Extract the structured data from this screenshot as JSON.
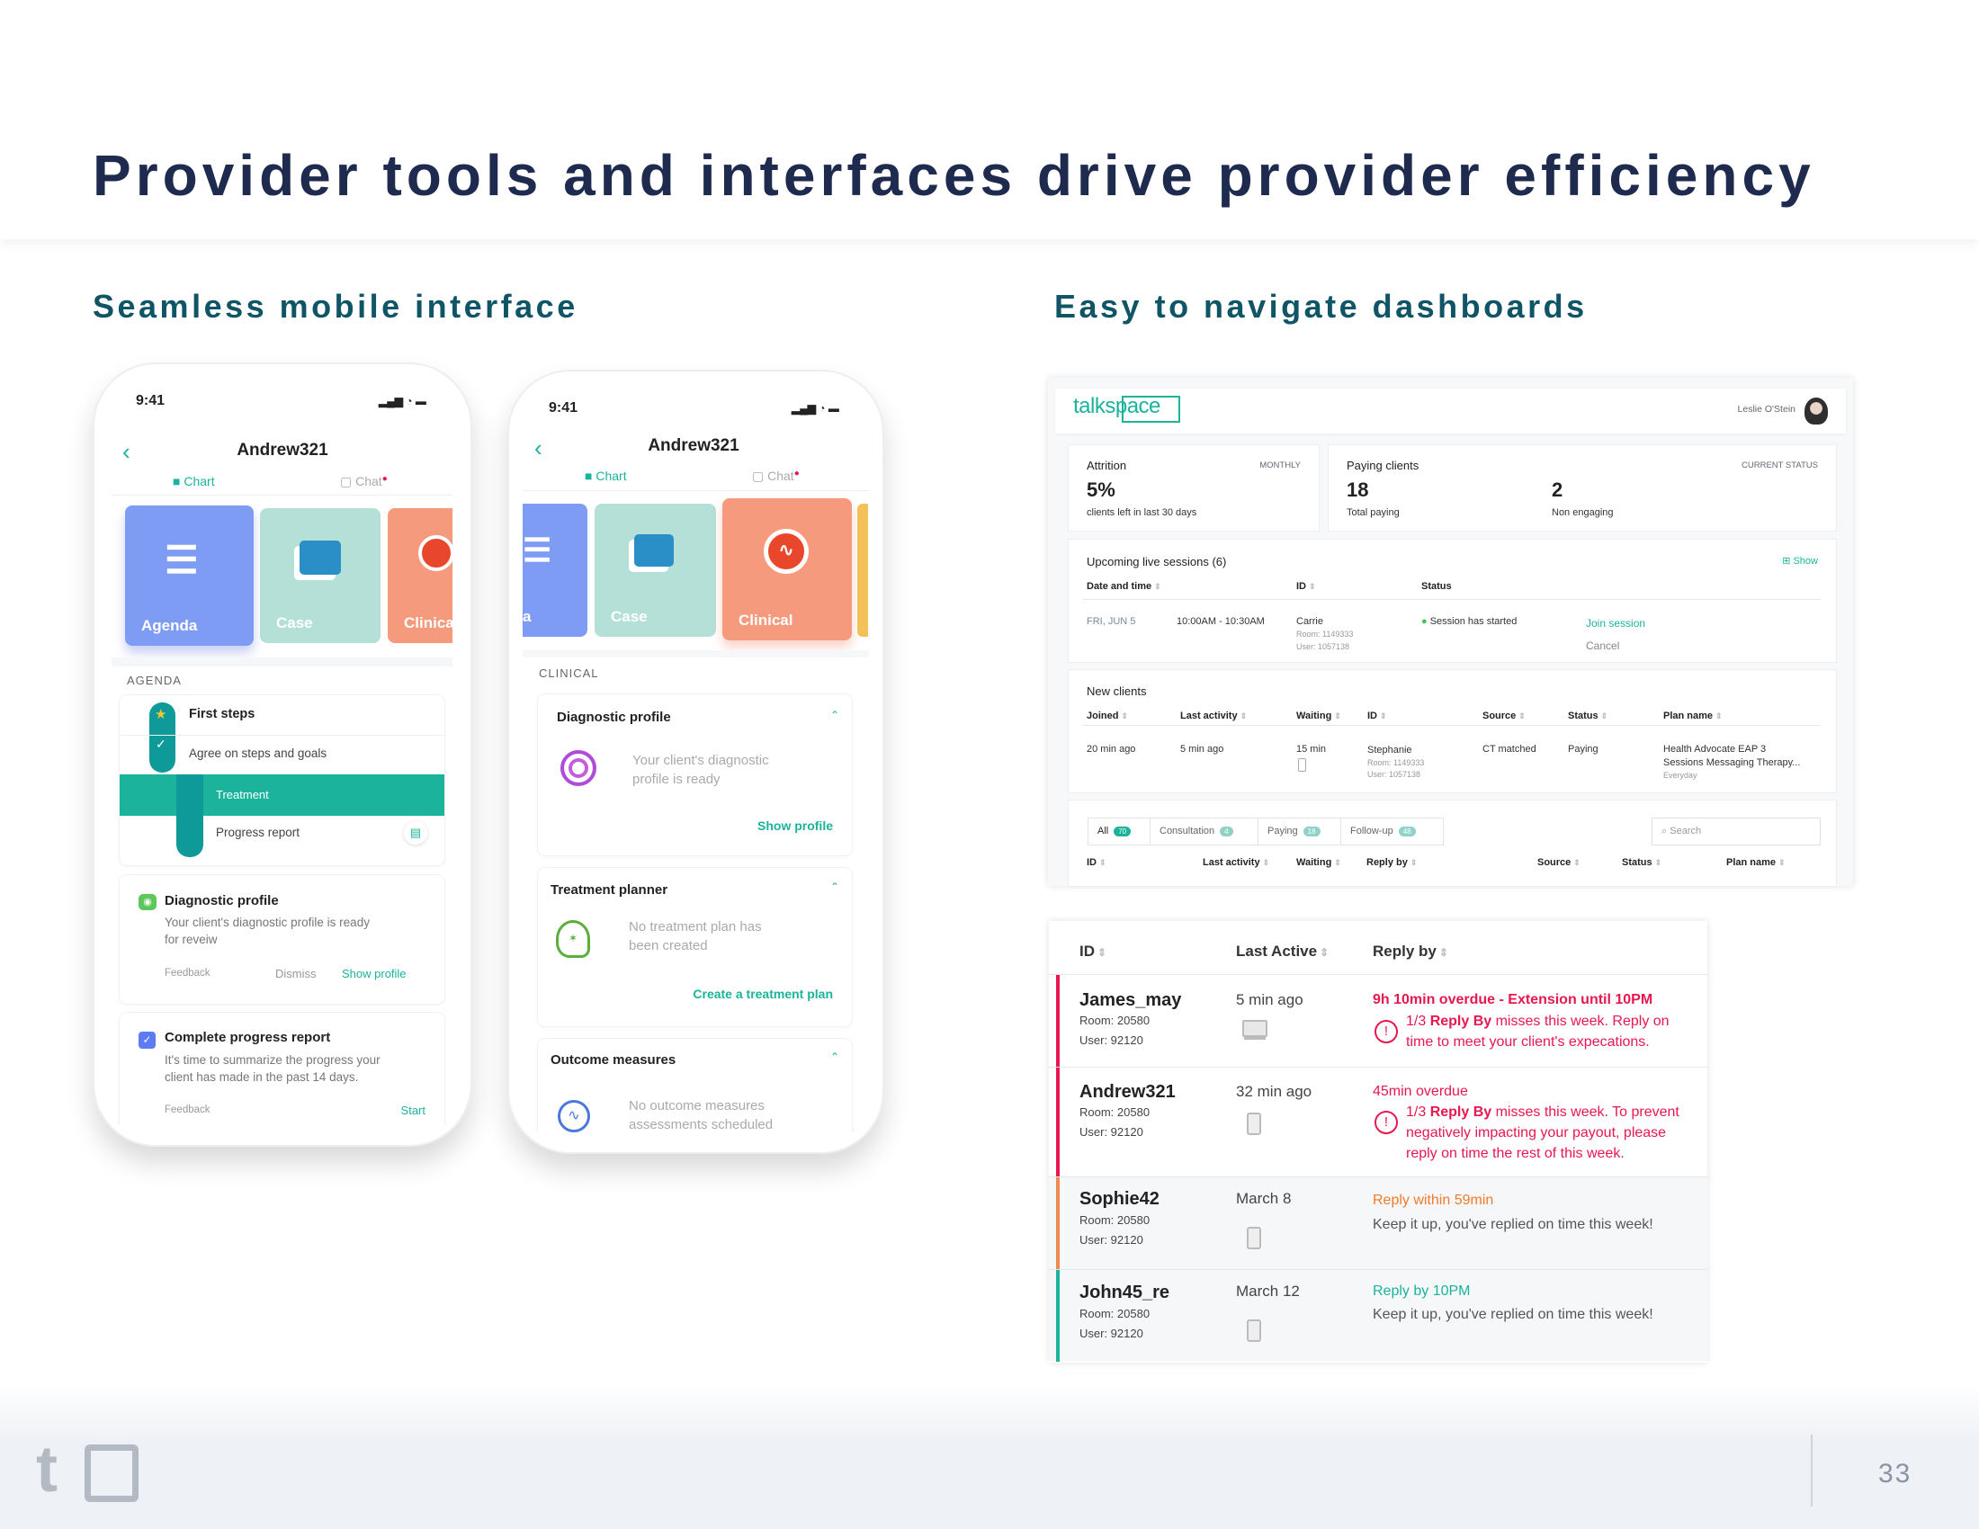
{
  "slide": {
    "title": "Provider tools and interfaces drive provider efficiency",
    "left_heading": "Seamless mobile interface",
    "right_heading": "Easy to navigate dashboards",
    "page_number": "33"
  },
  "colors": {
    "navy": "#1e2b4f",
    "teal": "#1bb39b",
    "red": "#e8174f",
    "orange": "#f07b2d",
    "agenda_tile": "#7f9cf5",
    "case_tile": "#b5e0d8",
    "clinical_tile": "#f59a7c"
  },
  "phone1": {
    "time": "9:41",
    "title": "Andrew321",
    "tab_chart": "Chart",
    "tab_chat": "Chat",
    "tiles": [
      "Agenda",
      "Case",
      "Clinical"
    ],
    "section": "AGENDA",
    "agenda": {
      "step1": "First steps",
      "step2": "Agree on steps and goals",
      "step3": "Treatment",
      "step4": "Progress report"
    },
    "diag": {
      "title": "Diagnostic profile",
      "text1": "Your client's diagnostic profile is ready",
      "text2": "for reveiw",
      "feedback": "Feedback",
      "dismiss": "Dismiss",
      "show": "Show profile"
    },
    "progress": {
      "title": "Complete progress report",
      "text1": "It's time to summarize the progress your",
      "text2": "client has made in the past 14 days.",
      "feedback": "Feedback",
      "start": "Start"
    }
  },
  "phone2": {
    "time": "9:41",
    "title": "Andrew321",
    "tab_chart": "Chart",
    "tab_chat": "Chat",
    "tiles": [
      "a",
      "Case",
      "Clinical"
    ],
    "section": "CLINICAL",
    "diag": {
      "title": "Diagnostic profile",
      "text1": "Your client's diagnostic",
      "text2": "profile is ready",
      "action": "Show profile"
    },
    "treat": {
      "title": "Treatment planner",
      "text1": "No treatment plan has",
      "text2": "been created",
      "action": "Create a treatment plan"
    },
    "outcome": {
      "title": "Outcome measures",
      "text1": "No outcome measures",
      "text2": "assessments scheduled"
    }
  },
  "dashboard": {
    "logo": "talkspace",
    "user": "Leslie O'Stein",
    "attrition": {
      "label": "Attrition",
      "period": "MONTHLY",
      "value": "5%",
      "sub": "clients left in last 30 days"
    },
    "paying": {
      "label": "Paying clients",
      "period": "CURRENT STATUS",
      "total": "18",
      "total_sub": "Total paying",
      "non": "2",
      "non_sub": "Non engaging"
    },
    "upcoming": {
      "title": "Upcoming live sessions (6)",
      "show": "Show",
      "headers": [
        "Date and time",
        "ID",
        "Status"
      ],
      "row": {
        "date": "FRI, JUN 5",
        "time": "10:00AM - 10:30AM",
        "name": "Carrie",
        "room": "Room: 1149333",
        "user": "User: 1057138",
        "status": "Session has started",
        "join": "Join session",
        "cancel": "Cancel"
      }
    },
    "new_clients": {
      "title": "New clients",
      "headers": [
        "Joined",
        "Last activity",
        "Waiting",
        "ID",
        "Source",
        "Status",
        "Plan name"
      ],
      "row": {
        "joined": "20 min ago",
        "last": "5 min ago",
        "waiting": "15 min",
        "name": "Stephanie",
        "room": "Room: 1149333",
        "user": "User: 1057138",
        "source": "CT matched",
        "status": "Paying",
        "plan1": "Health Advocate EAP 3",
        "plan2": "Sessions Messaging Therapy...",
        "plan3": "Everyday"
      }
    },
    "filters": [
      {
        "label": "All",
        "count": "70"
      },
      {
        "label": "Consultation",
        "count": "4"
      },
      {
        "label": "Paying",
        "count": "18"
      },
      {
        "label": "Follow-up",
        "count": "48"
      }
    ],
    "search_placeholder": "Search",
    "list_headers": [
      "ID",
      "Last activity",
      "Waiting",
      "Reply by",
      "Source",
      "Status",
      "Plan name"
    ]
  },
  "reply_table": {
    "headers": [
      "ID",
      "Last Active",
      "Reply by"
    ],
    "rows": [
      {
        "name": "James_may",
        "room": "Room: 20580",
        "user": "User: 92120",
        "last": "5 min ago",
        "device": "desktop",
        "status": "9h 10min overdue - Extension until 10PM",
        "warn_bold": "Reply By",
        "warn_pre": "1/3 ",
        "warn1": " misses this week. Reply on",
        "warn2": "time to meet your client's expecations.",
        "warn3": ""
      },
      {
        "name": "Andrew321",
        "room": "Room: 20580",
        "user": "User: 92120",
        "last": "32 min ago",
        "device": "mobile",
        "status": "45min overdue",
        "warn_bold": "Reply By",
        "warn_pre": "1/3 ",
        "warn1": " misses this week. To prevent",
        "warn2": "negatively impacting your payout, please",
        "warn3": "reply on time the rest of this week."
      },
      {
        "name": "Sophie42",
        "room": "Room: 20580",
        "user": "User: 92120",
        "last": "March 8",
        "device": "mobile",
        "status": "Reply within 59min",
        "note": "Keep it up, you've replied on time this week!"
      },
      {
        "name": "John45_re",
        "room": "Room: 20580",
        "user": "User: 92120",
        "last": "March 12",
        "device": "mobile",
        "status": "Reply by 10PM",
        "note": "Keep it up, you've replied on time this week!"
      }
    ]
  }
}
